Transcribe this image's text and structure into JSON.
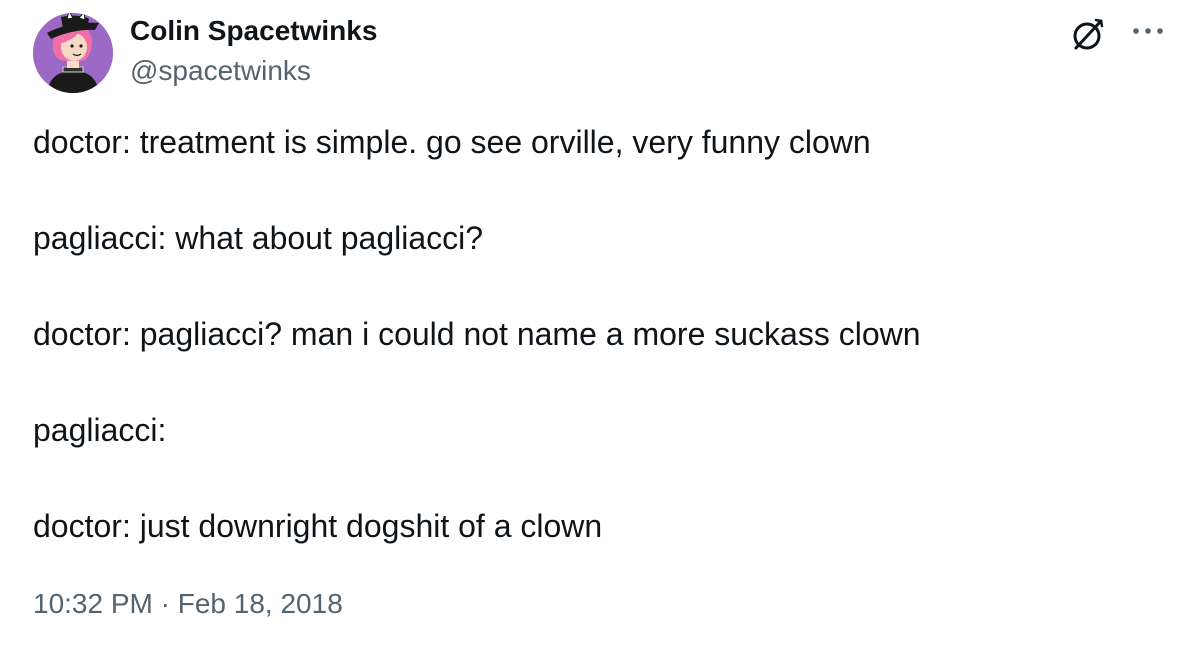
{
  "author": {
    "display_name": "Colin Spacetwinks",
    "handle": "@spacetwinks"
  },
  "icons": {
    "grok": "grok-icon",
    "more": "more-icon",
    "avatar": "avatar-illustration"
  },
  "tweet": {
    "lines": [
      "doctor: treatment is simple. go see orville, very funny clown",
      "pagliacci: what about pagliacci?",
      "doctor: pagliacci? man i could not name a more suckass clown",
      "pagliacci:",
      "doctor: just downright dogshit of a clown"
    ],
    "time": "10:32 PM",
    "separator": "·",
    "date": "Feb 18, 2018"
  },
  "colors": {
    "text": "#0f1419",
    "secondary": "#536471",
    "avatar_bg": "#9c6ac6",
    "hair": "#f06fa8"
  }
}
